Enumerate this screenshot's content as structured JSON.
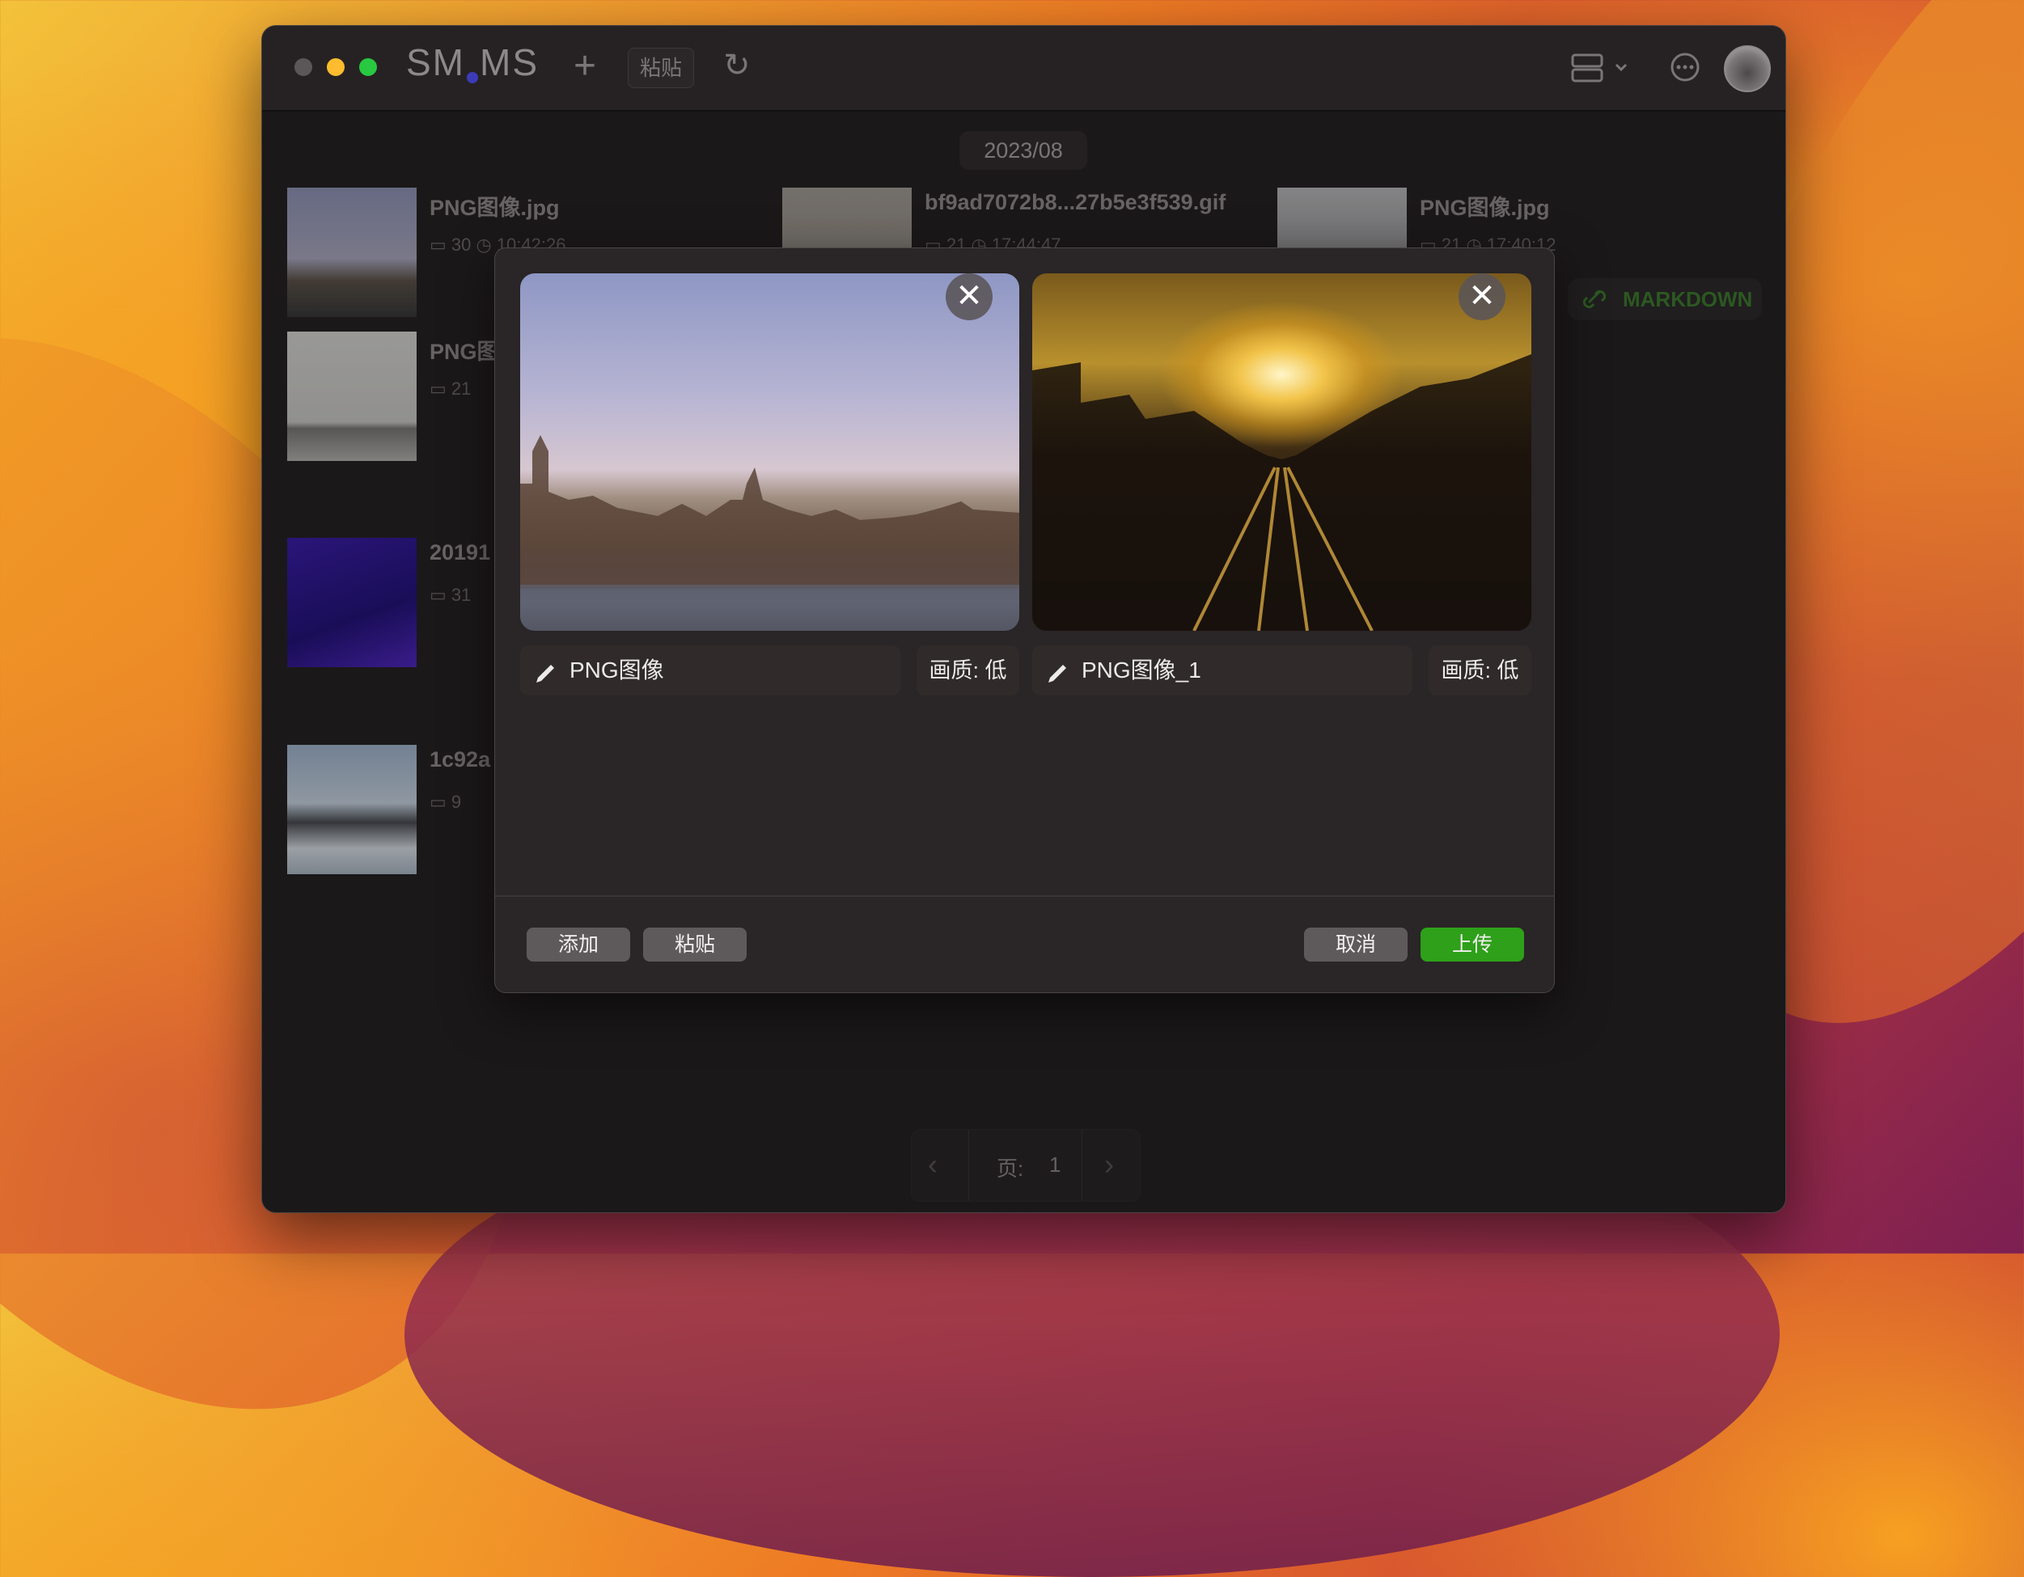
{
  "app": {
    "brand_left": "SM",
    "brand_right": "MS"
  },
  "toolbar": {
    "paste_label": "粘贴",
    "add_glyph": "+",
    "refresh_glyph": "↻",
    "more_glyph": "···"
  },
  "gallery": {
    "date_header": "2023/08",
    "items": [
      {
        "name": "PNG图像.jpg",
        "day": "30",
        "time": "10:42:26"
      },
      {
        "name": "bf9ad7072b8...27b5e3f539.gif",
        "day": "21",
        "time": "17:44:47"
      },
      {
        "name": "PNG图像.jpg",
        "day": "21",
        "time": "17:40:12"
      },
      {
        "name": "PNG图",
        "day": "21",
        "time": ""
      },
      {
        "name": "20191",
        "day": "31",
        "time": ""
      },
      {
        "name": "1c92a",
        "day": "9",
        "time": ""
      }
    ],
    "markdown_label": "MARKDOWN"
  },
  "pagination": {
    "page_label": "页:",
    "page_number": "1"
  },
  "upload_dialog": {
    "items": [
      {
        "name": "PNG图像",
        "quality": "画质: 低"
      },
      {
        "name": "PNG图像_1",
        "quality": "画质: 低"
      }
    ],
    "add_label": "添加",
    "paste_label": "粘贴",
    "cancel_label": "取消",
    "upload_label": "上传"
  },
  "colors": {
    "accent_green": "#2ea01a",
    "close_red": "#ff5f57",
    "minimize_yellow": "#febc2e",
    "zoom_green": "#28c840"
  }
}
